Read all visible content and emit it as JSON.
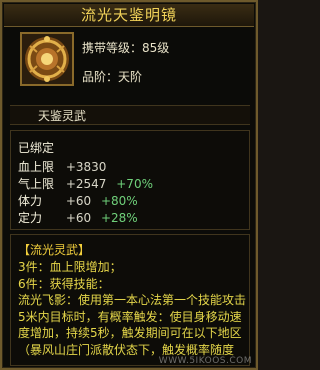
{
  "item": {
    "title": "流光天鉴明镜",
    "carry_level": "携带等级：85级",
    "grade": "品阶：天阶"
  },
  "panel": {
    "name": "天鉴灵武"
  },
  "stats": {
    "bound": "已绑定",
    "rows": [
      {
        "name": "血上限",
        "value": "+3830",
        "extra": ""
      },
      {
        "name": "气上限",
        "value": "+2547",
        "extra": "+70%"
      },
      {
        "name": "体力",
        "value": "+60",
        "extra": "+80%"
      },
      {
        "name": "定力",
        "value": "+60",
        "extra": "+28%"
      }
    ]
  },
  "set": {
    "title": "【流光灵武】",
    "piece3": "3件：血上限增加；",
    "piece6": "6件：获得技能：",
    "description": "流光飞影：使用第一本心法第一个技能攻击5米内目标时，有概率触发：使目身移动速度增加，持续5秒，触发期间可在以下地区（暴风山庄门派散伏态下，触发概率随度"
  },
  "watermark": "WWW.5IKOOS.COM",
  "colors": {
    "title": "#f2d35a",
    "border": "#6e5a2c",
    "bonus": "#6fd07a",
    "set_text": "#e8d84a"
  }
}
